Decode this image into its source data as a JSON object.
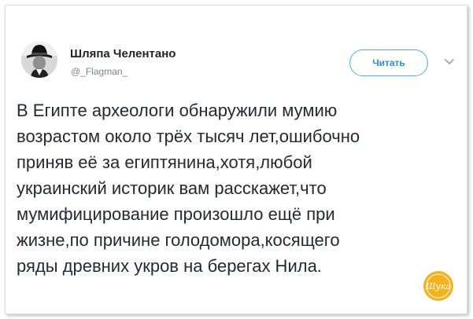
{
  "tweet": {
    "author_name": "Шляпа Челентано",
    "author_handle": "@_Flagman_",
    "follow_label": "Читать",
    "text_lines": [
      "В Египте археологи обнаружили мумию",
      "возрастом около трёх тысяч лет,ошибочно",
      "приняв её за египтянина,хотя,любой",
      "украинский историк вам расскажет,что",
      "мумифицирование произошло ещё при",
      "жизне,по причине голодомора,косящего",
      "ряды древних укров на берегах Нила."
    ]
  },
  "icons": {
    "avatar": "man-in-hat-avatar",
    "menu": "chevron-down-icon",
    "watermark": "yellow-round-logo"
  },
  "colors": {
    "follow_border": "#58a8e6",
    "follow_text": "#2d8fd7",
    "text": "#222a33",
    "handle": "#7b8590",
    "watermark": "#f3b21e"
  },
  "watermark": {
    "logo_text": "Шука"
  }
}
